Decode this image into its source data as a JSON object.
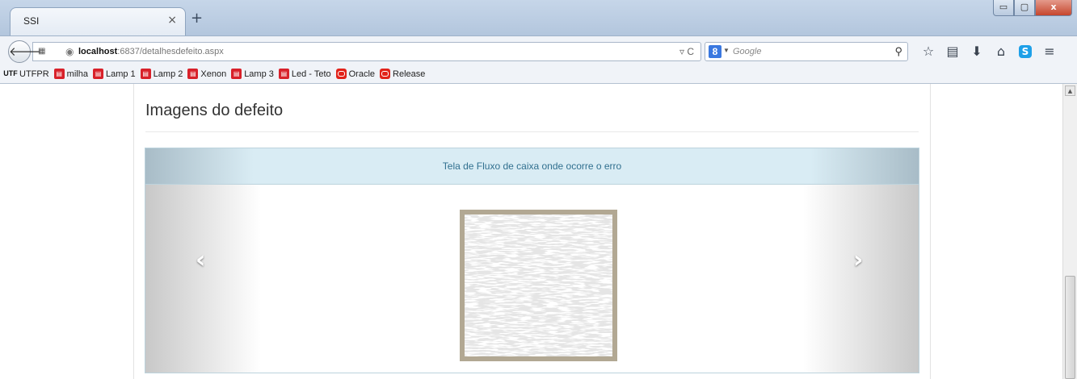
{
  "browser": {
    "tab_title": "SSI",
    "tab_close": "×",
    "new_tab": "+",
    "window_buttons": {
      "minimize": "▭",
      "maximize": "▢",
      "close": "x"
    },
    "url_host": "localhost",
    "url_rest": ":6837/detalhesdefeito.aspx",
    "search_engine": "8",
    "search_placeholder": "Google"
  },
  "bookmarks": [
    {
      "label": "UTFPR",
      "icon": "utf-icon"
    },
    {
      "label": "milha",
      "icon": "cart-icon"
    },
    {
      "label": "Lamp 1",
      "icon": "cart-icon"
    },
    {
      "label": "Lamp 2",
      "icon": "cart-icon"
    },
    {
      "label": "Xenon",
      "icon": "cart-icon"
    },
    {
      "label": "Lamp 3",
      "icon": "cart-icon"
    },
    {
      "label": "Led - Teto",
      "icon": "cart-icon"
    },
    {
      "label": "Oracle",
      "icon": "oracle-icon"
    },
    {
      "label": "Release",
      "icon": "oracle-icon"
    }
  ],
  "page": {
    "heading": "Imagens do defeito",
    "carousel_caption": "Tela de Fluxo de caixa onde ocorre o erro"
  },
  "colors": {
    "caption_text": "#31708f",
    "panel_bg": "#d9ecf4",
    "image_frame": "#b2a893"
  }
}
